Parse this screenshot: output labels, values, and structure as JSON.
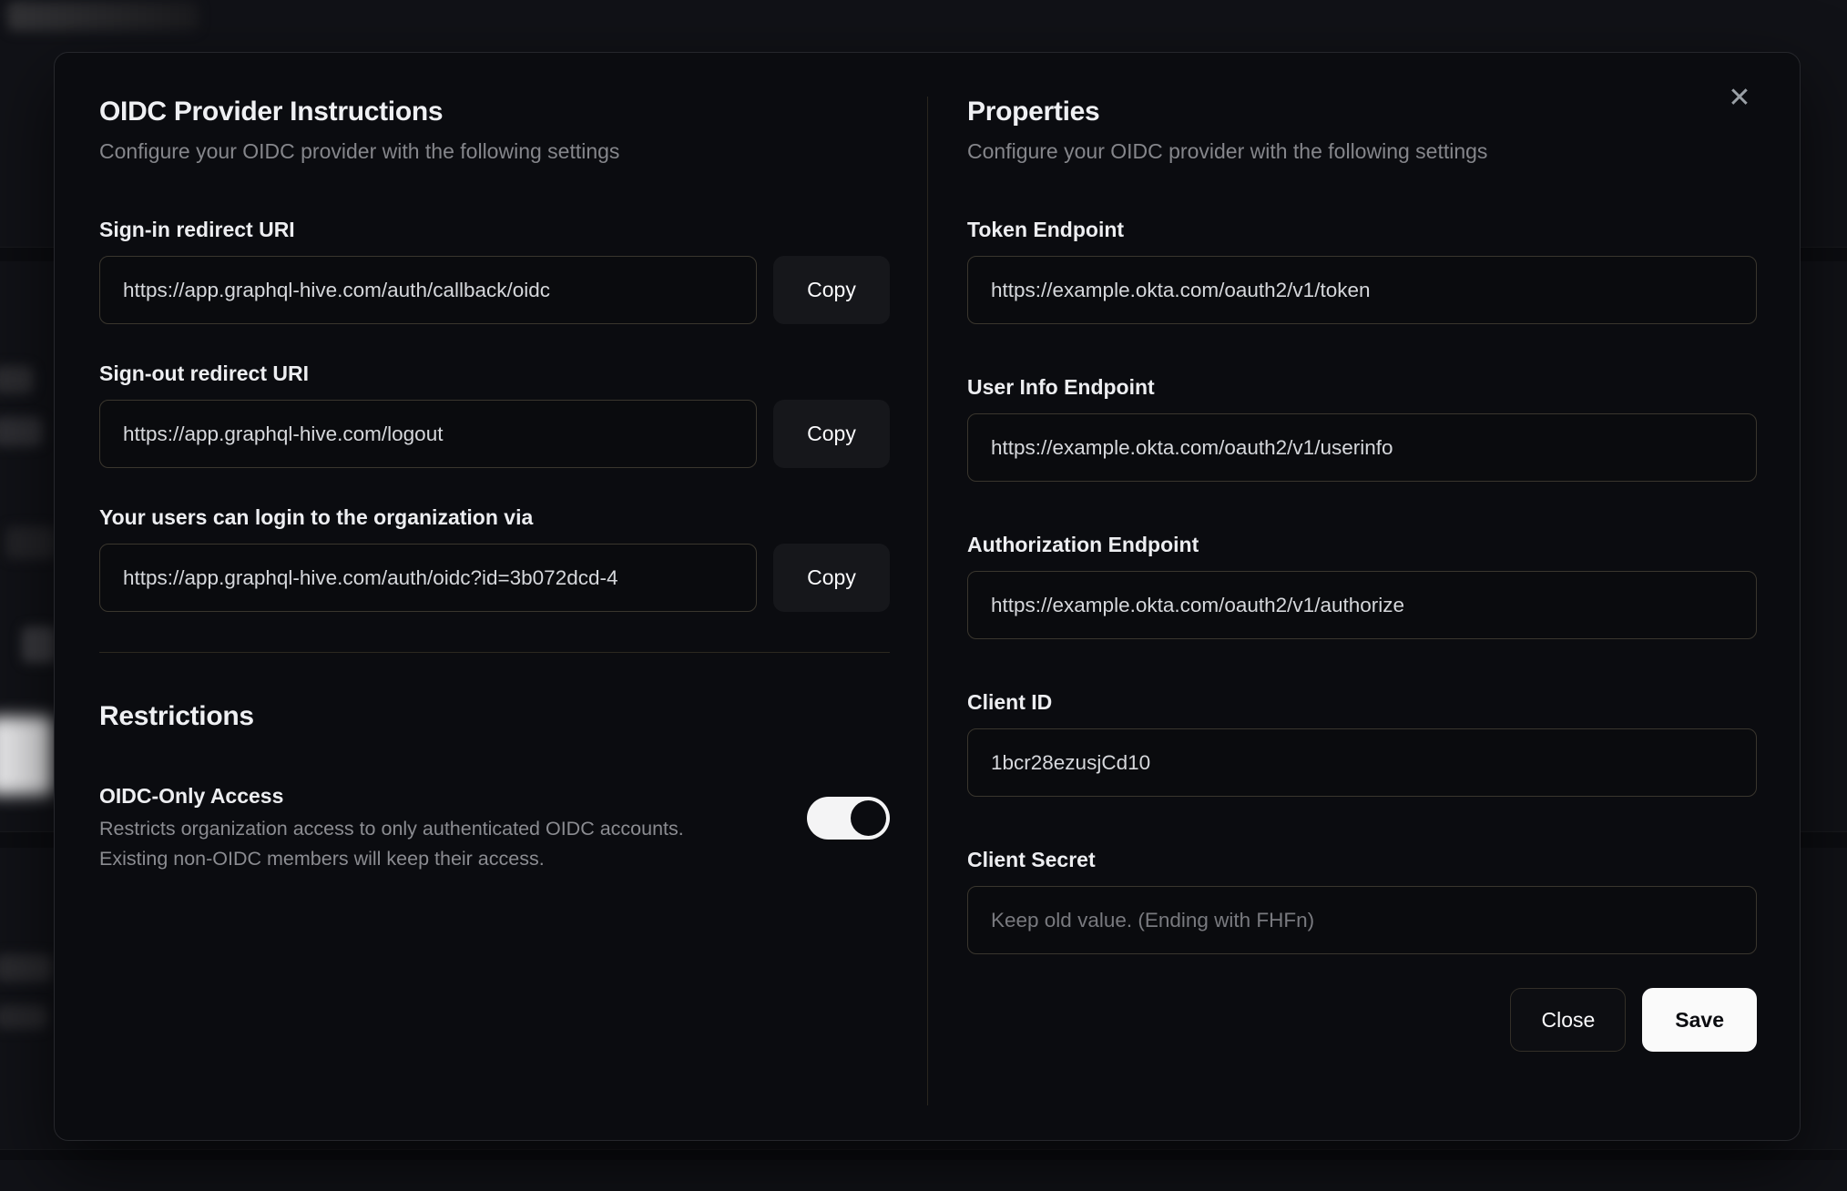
{
  "modal": {
    "close_icon": "✕",
    "left": {
      "title": "OIDC Provider Instructions",
      "subtitle": "Configure your OIDC provider with the following settings",
      "fields": [
        {
          "label": "Sign-in redirect URI",
          "value": "https://app.graphql-hive.com/auth/callback/oidc",
          "button": "Copy"
        },
        {
          "label": "Sign-out redirect URI",
          "value": "https://app.graphql-hive.com/logout",
          "button": "Copy"
        },
        {
          "label": "Your users can login to the organization via",
          "value": "https://app.graphql-hive.com/auth/oidc?id=3b072dcd-4",
          "button": "Copy"
        }
      ],
      "restrictions": {
        "title": "Restrictions",
        "toggle_label": "OIDC-Only Access",
        "description_line1": "Restricts organization access to only authenticated OIDC accounts.",
        "description_line2": "Existing non-OIDC members will keep their access.",
        "toggle_on": true
      }
    },
    "right": {
      "title": "Properties",
      "subtitle": "Configure your OIDC provider with the following settings",
      "fields": [
        {
          "label": "Token Endpoint",
          "value": "https://example.okta.com/oauth2/v1/token"
        },
        {
          "label": "User Info Endpoint",
          "value": "https://example.okta.com/oauth2/v1/userinfo"
        },
        {
          "label": "Authorization Endpoint",
          "value": "https://example.okta.com/oauth2/v1/authorize"
        },
        {
          "label": "Client ID",
          "value": "1bcr28ezusjCd10"
        },
        {
          "label": "Client Secret",
          "value": "",
          "placeholder": "Keep old value. (Ending with FHFn)"
        }
      ],
      "footer": {
        "close": "Close",
        "save": "Save"
      }
    }
  },
  "colors": {
    "modal_bg": "#0b0c10",
    "input_border": "#3a362e",
    "toggle_on": "#f4f4f5",
    "save_bg": "#fafafa",
    "heading_text": "#eff0f3",
    "muted_text": "#85868b"
  }
}
